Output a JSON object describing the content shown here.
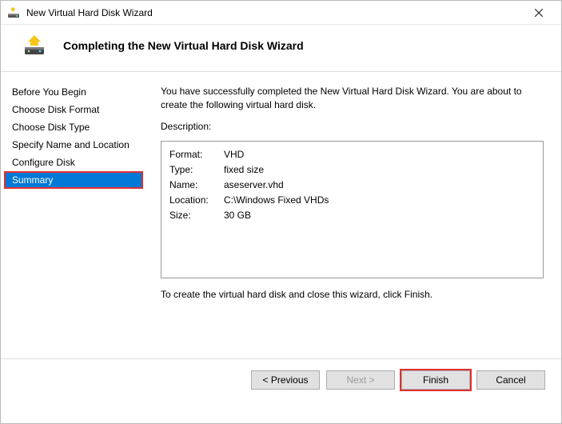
{
  "window": {
    "title": "New Virtual Hard Disk Wizard"
  },
  "header": {
    "title": "Completing the New Virtual Hard Disk Wizard"
  },
  "sidebar": {
    "items": [
      {
        "label": "Before You Begin",
        "selected": false
      },
      {
        "label": "Choose Disk Format",
        "selected": false
      },
      {
        "label": "Choose Disk Type",
        "selected": false
      },
      {
        "label": "Specify Name and Location",
        "selected": false
      },
      {
        "label": "Configure Disk",
        "selected": false
      },
      {
        "label": "Summary",
        "selected": true
      }
    ]
  },
  "content": {
    "intro": "You have successfully completed the New Virtual Hard Disk Wizard. You are about to create the following virtual hard disk.",
    "description_label": "Description:",
    "details": [
      {
        "key": "Format:",
        "value": "VHD"
      },
      {
        "key": "Type:",
        "value": "fixed size"
      },
      {
        "key": "Name:",
        "value": "aseserver.vhd"
      },
      {
        "key": "Location:",
        "value": "C:\\Windows Fixed VHDs"
      },
      {
        "key": "Size:",
        "value": "30 GB"
      }
    ],
    "outro": "To create the virtual hard disk and close this wizard, click Finish."
  },
  "footer": {
    "previous": "< Previous",
    "next": "Next >",
    "finish": "Finish",
    "cancel": "Cancel"
  }
}
